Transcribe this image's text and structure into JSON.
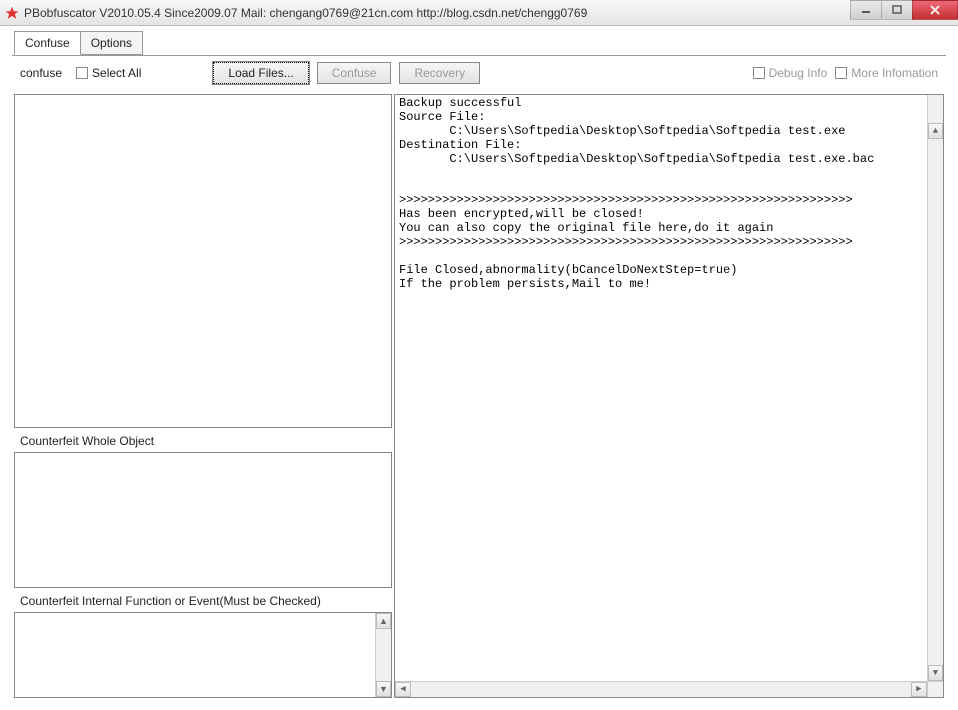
{
  "window": {
    "title": "PBobfuscator  V2010.05.4 Since2009.07  Mail: chengang0769@21cn.com  http://blog.csdn.net/chengg0769"
  },
  "tabs": [
    {
      "label": "Confuse",
      "active": true
    },
    {
      "label": "Options",
      "active": false
    }
  ],
  "toolbar": {
    "confuse_label": "confuse",
    "select_all_label": "Select All",
    "load_files_label": "Load Files...",
    "confuse_btn_label": "Confuse",
    "recovery_label": "Recovery",
    "debug_info_label": "Debug Info",
    "more_info_label": "More Infomation"
  },
  "panels": {
    "counterfeit_whole": "Counterfeit Whole Object",
    "counterfeit_internal": "Counterfeit Internal Function or Event(Must be Checked)"
  },
  "log": {
    "lines": [
      "Backup successful",
      "Source File:",
      "       C:\\Users\\Softpedia\\Desktop\\Softpedia\\Softpedia test.exe",
      "Destination File:",
      "       C:\\Users\\Softpedia\\Desktop\\Softpedia\\Softpedia test.exe.bac",
      "",
      "",
      ">>>>>>>>>>>>>>>>>>>>>>>>>>>>>>>>>>>>>>>>>>>>>>>>>>>>>>>>>>>>>>>",
      "Has been encrypted,will be closed!",
      "You can also copy the original file here,do it again",
      ">>>>>>>>>>>>>>>>>>>>>>>>>>>>>>>>>>>>>>>>>>>>>>>>>>>>>>>>>>>>>>>",
      "",
      "File Closed,abnormality(bCancelDoNextStep=true)",
      "If the problem persists,Mail to me!"
    ]
  }
}
